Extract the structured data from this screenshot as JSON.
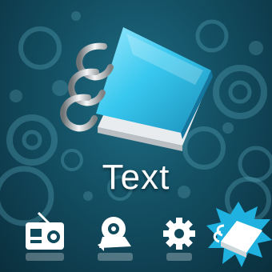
{
  "screen": {
    "title": "Text"
  },
  "menu": {
    "items": [
      {
        "icon": "radio-icon",
        "selected": false
      },
      {
        "icon": "camera-icon",
        "selected": false
      },
      {
        "icon": "settings-gear-icon",
        "selected": false
      },
      {
        "icon": "text-notebook-icon",
        "selected": true
      }
    ]
  },
  "colors": {
    "background": "#134f63",
    "accent": "#31c8ee",
    "text": "#ffffff"
  }
}
